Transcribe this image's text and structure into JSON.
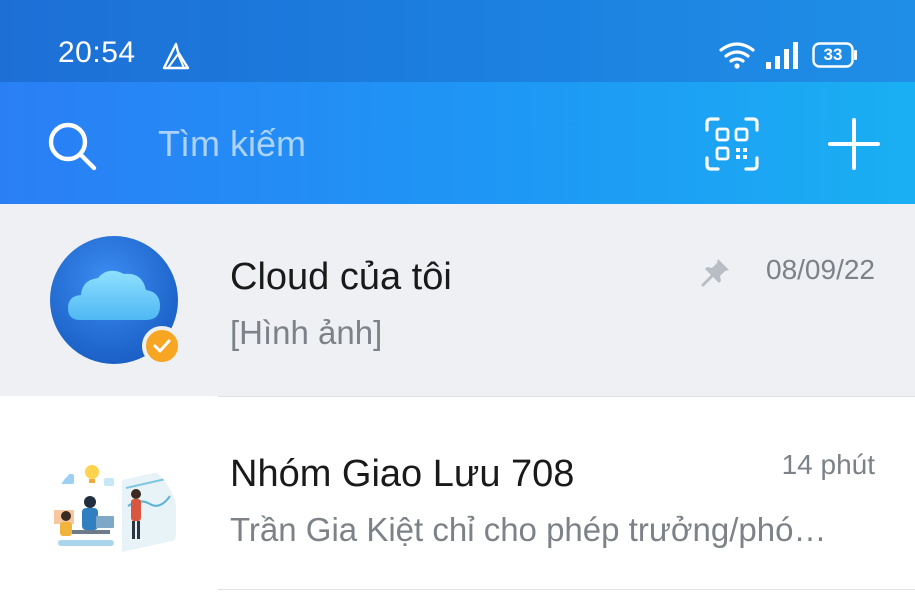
{
  "status_bar": {
    "time": "20:54",
    "battery": "33",
    "app_icon": "book-arrow-icon",
    "wifi_icon": "wifi-icon",
    "signal_icon": "signal-icon"
  },
  "search_bar": {
    "placeholder": "Tìm kiếm",
    "search_icon": "search-icon",
    "qr_icon": "qr-scan-icon",
    "add_icon": "plus-icon"
  },
  "chats": [
    {
      "name": "Cloud của tôi",
      "preview": "[Hình ảnh]",
      "time": "08/09/22",
      "pinned": true,
      "avatar_icon": "cloud-icon",
      "badge_icon": "verified-check-icon"
    },
    {
      "name": "Nhóm Giao Lưu 708",
      "preview": "Trần Gia Kiệt chỉ cho phép trưởng/phó…",
      "time": "14 phút",
      "pinned": false,
      "avatar_icon": "group-illustration"
    }
  ],
  "colors": {
    "status_bar": "#1d6fd6",
    "header_start": "#2a7ff5",
    "header_end": "#1aaff2",
    "pinned_background": "#eef0f3",
    "badge": "#f6a623"
  }
}
